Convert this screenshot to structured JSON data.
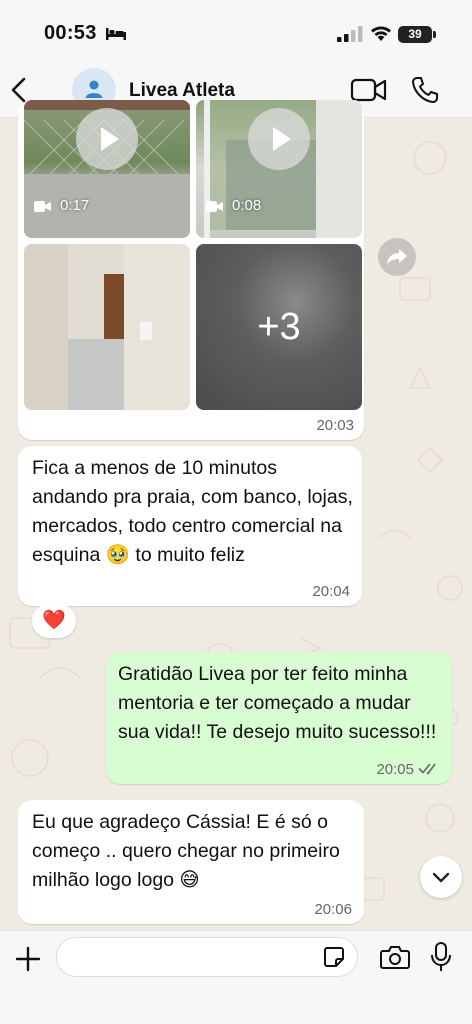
{
  "status_bar": {
    "time": "00:53",
    "battery": "39"
  },
  "header": {
    "contact_name": "Livea Atleta"
  },
  "media": {
    "videos": [
      {
        "duration": "0:17"
      },
      {
        "duration": "0:08"
      }
    ],
    "more_count": "+3",
    "time": "20:03"
  },
  "messages": [
    {
      "direction": "in",
      "text": "Fica a menos de 10 minutos andando pra praia, com banco, lojas, mercados, todo centro comercial na esquina 🥹 to muito feliz",
      "time": "20:04",
      "reaction": "❤️"
    },
    {
      "direction": "out",
      "text": "Gratidão Livea por ter feito minha mentoria e ter começado a mudar sua vida!! Te desejo muito sucesso!!!",
      "time": "20:05",
      "status": "read"
    },
    {
      "direction": "in",
      "text": "Eu que agradeço Cássia! E é só o começo .. quero chegar no primeiro milhão logo logo 😅",
      "time": "20:06"
    }
  ],
  "composer": {
    "placeholder": ""
  },
  "colors": {
    "incoming": "#ffffff",
    "outgoing": "#d9fdd3",
    "background": "#efeae2",
    "read_ticks": "#53bdeb"
  },
  "icons": [
    "bed-icon",
    "signal-icon",
    "wifi-icon",
    "back-arrow-icon",
    "person-icon",
    "video-call-icon",
    "phone-icon",
    "forward-icon",
    "chevron-down-icon",
    "plus-icon",
    "sticker-icon",
    "camera-icon",
    "mic-icon"
  ]
}
